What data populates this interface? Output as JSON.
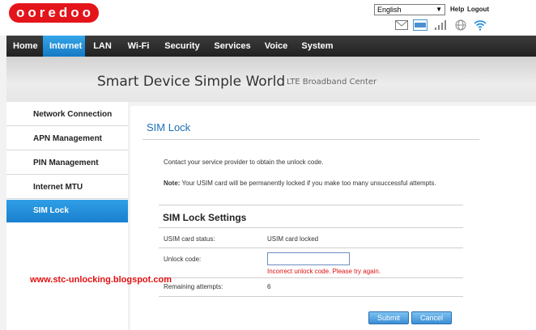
{
  "brand": {
    "logo_letters": [
      "o",
      "o",
      "r",
      "e",
      "d",
      "o",
      "o"
    ]
  },
  "header": {
    "language": "English",
    "help": "Help",
    "logout": "Logout",
    "status_icons": [
      "mail-icon",
      "sms-icon",
      "signal-icon",
      "globe-icon",
      "wifi-icon"
    ]
  },
  "nav": {
    "items": [
      "Home",
      "Internet",
      "LAN",
      "Wi-Fi",
      "Security",
      "Services",
      "Voice",
      "System"
    ],
    "active": "Internet"
  },
  "banner": {
    "tagline_part1": "Smart Device",
    "tagline_part2": "Simple World",
    "tagline_sub": "LTE Broadband Center"
  },
  "sidebar": {
    "items": [
      "Network Connection",
      "APN Management",
      "PIN Management",
      "Internet MTU",
      "SIM Lock"
    ],
    "active": "SIM Lock"
  },
  "main": {
    "title": "SIM Lock",
    "intro": "Contact your service provider to obtain the unlock code.",
    "note_label": "Note:",
    "note_text": "Your USIM card will be permanently locked if you make too many unsuccessful attempts.",
    "section_title": "SIM Lock Settings",
    "rows": {
      "status_label": "USIM card status:",
      "status_value": "USIM card locked",
      "code_label": "Unlock code:",
      "code_value": "",
      "code_error": "Incorrect unlock code. Please try again.",
      "attempts_label": "Remaining attempts:",
      "attempts_value": "6"
    },
    "buttons": {
      "submit": "Submit",
      "cancel": "Cancel"
    }
  },
  "watermark": "www.stc-unlocking.blogspot.com",
  "colors": {
    "brand_red": "#e4141b",
    "accent_blue": "#1a7fcf",
    "error_red": "#d11111"
  }
}
